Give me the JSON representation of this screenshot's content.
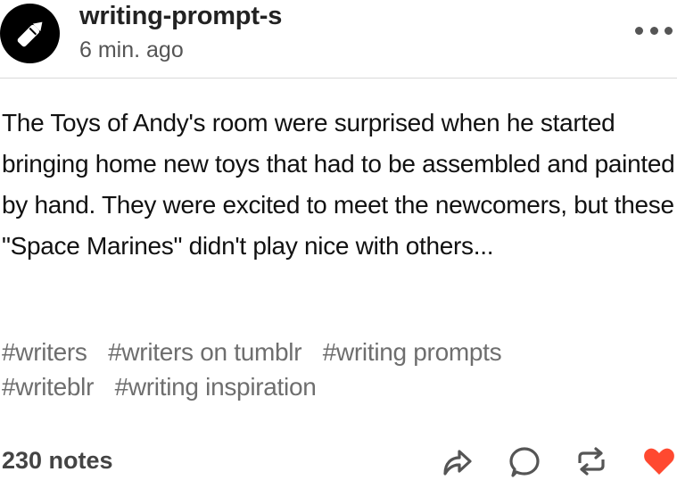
{
  "post": {
    "blog_name": "writing-prompt-s",
    "time": "6 min. ago",
    "body": "The Toys of Andy's room were surprised when he started bringing home new toys that had to be assembled and painted by hand. They were excited to meet the newcomers, but these \"Space Marines\" didn't play nice with others...",
    "tags": [
      "#writers",
      "#writers on tumblr",
      "#writing prompts",
      "#writeblr",
      "#writing inspiration"
    ],
    "notes": "230 notes"
  },
  "icons": {
    "avatar": "pen-icon",
    "more": "ellipsis-icon",
    "share": "share-icon",
    "reply": "comment-icon",
    "reblog": "reblog-icon",
    "like": "heart-icon"
  },
  "colors": {
    "text": "#111111",
    "tag": "#6e6e6e",
    "divider": "#d9d9d9",
    "icon": "#555555",
    "like": "#ff4930"
  }
}
